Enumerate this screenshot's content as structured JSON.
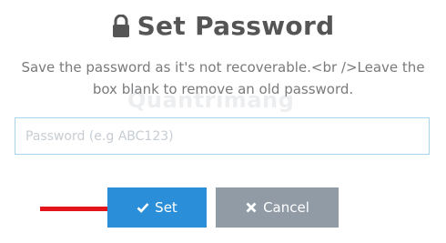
{
  "dialog": {
    "title": "Set Password",
    "title_icon": "lock-icon",
    "description": "Save the password as it's not recoverable.<br />Leave the box blank to remove an old password.",
    "input": {
      "value": "",
      "placeholder": "Password (e.g ABC123)"
    },
    "buttons": {
      "set": {
        "label": "Set",
        "icon": "check-icon",
        "color": "#2a8fd8"
      },
      "cancel": {
        "label": "Cancel",
        "icon": "close-icon",
        "color": "#909ba5"
      }
    }
  },
  "annotation": {
    "arrow_icon": "red-arrow-icon",
    "color": "#e3151a"
  },
  "watermark": "Quantrimang"
}
